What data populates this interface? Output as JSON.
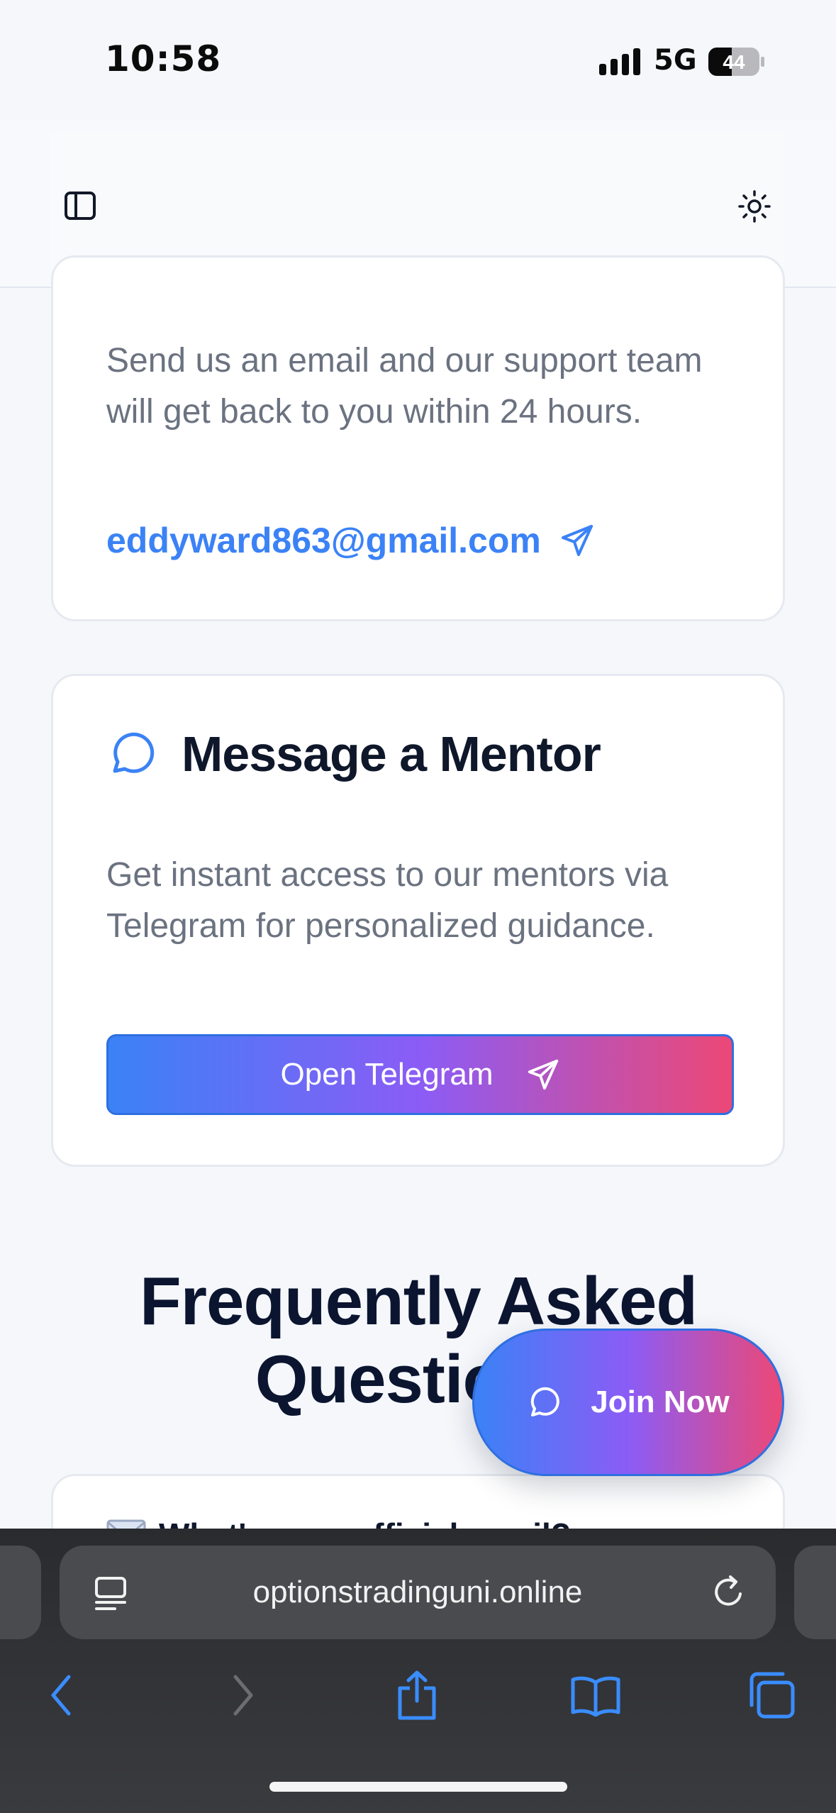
{
  "status_bar": {
    "time": "10:58",
    "network": "5G",
    "battery": "44"
  },
  "header": {
    "sidebar_icon": "sidebar-toggle-icon",
    "theme_icon": "sun-icon"
  },
  "email_card": {
    "description": "Send us an email and our support team will get back to you within 24 hours.",
    "email": "eddyward863@gmail.com",
    "icon": "send-icon"
  },
  "mentor_card": {
    "title": "Message a Mentor",
    "icon": "chat-bubble-icon",
    "description": "Get instant access to our mentors via Telegram for personalized guidance.",
    "button_label": "Open Telegram"
  },
  "faq": {
    "heading": "Frequently Asked Questions",
    "first_question": "What's your official email?"
  },
  "join_button": {
    "label": "Join Now",
    "icon": "chat-bubble-icon"
  },
  "browser": {
    "url": "optionstradinguni.online",
    "forward_enabled": false
  },
  "colors": {
    "accent_blue": "#3b82f6",
    "accent_pink": "#ec4876",
    "accent_purple": "#8b5cf6",
    "heading_dark": "#0f172a",
    "body_gray": "#6b7280"
  }
}
